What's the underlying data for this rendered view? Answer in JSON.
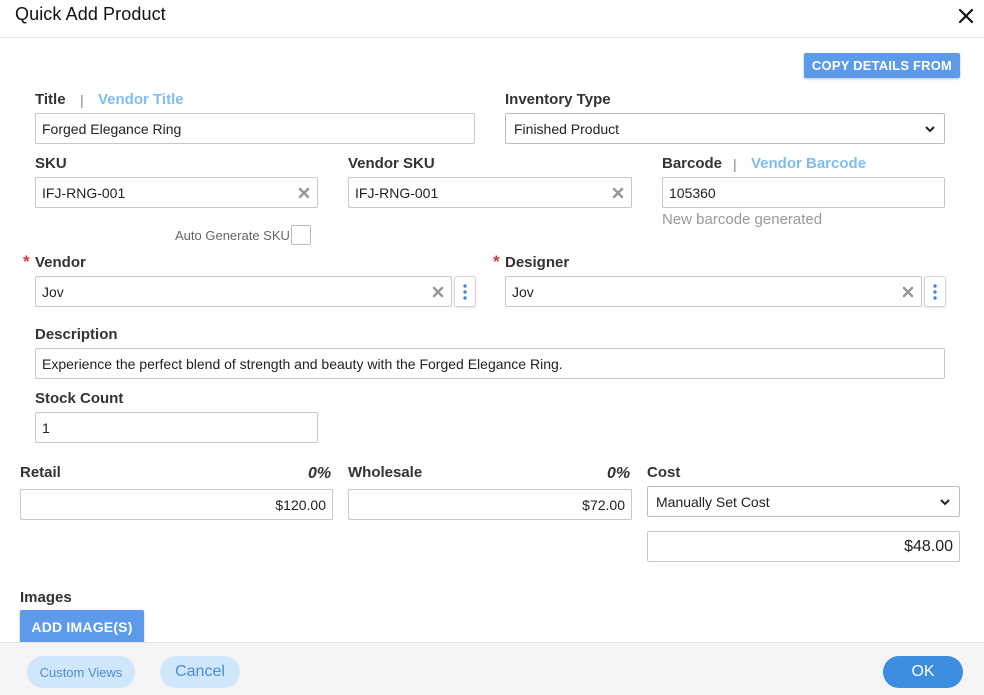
{
  "dialog": {
    "title": "Quick Add Product"
  },
  "actions": {
    "copy_details": "COPY DETAILS FROM"
  },
  "fields": {
    "title": {
      "label": "Title",
      "separator": "|",
      "alt_label": "Vendor Title",
      "value": "Forged Elegance Ring"
    },
    "inventory_type": {
      "label": "Inventory Type",
      "value": "Finished Product"
    },
    "sku": {
      "label": "SKU",
      "value": "IFJ-RNG-001"
    },
    "vendor_sku": {
      "label": "Vendor SKU",
      "value": "IFJ-RNG-001"
    },
    "barcode": {
      "label": "Barcode",
      "separator": "|",
      "alt_label": "Vendor Barcode",
      "value": "105360",
      "hint": "New barcode generated"
    },
    "auto_sku": {
      "label": "Auto Generate SKU",
      "checked": false
    },
    "vendor": {
      "required_mark": "*",
      "label": "Vendor",
      "value": "Jov"
    },
    "designer": {
      "required_mark": "*",
      "label": "Designer",
      "value": "Jov"
    },
    "description": {
      "label": "Description",
      "value": "Experience the perfect blend of strength and beauty with the Forged Elegance Ring."
    },
    "stock_count": {
      "label": "Stock Count",
      "value": "1"
    },
    "retail": {
      "label": "Retail",
      "percent": "0%",
      "value": "$120.00"
    },
    "wholesale": {
      "label": "Wholesale",
      "percent": "0%",
      "value": "$72.00"
    },
    "cost": {
      "label": "Cost",
      "method": "Manually Set Cost",
      "value": "$48.00"
    }
  },
  "images": {
    "label": "Images",
    "add_button": "ADD IMAGE(S)"
  },
  "footer": {
    "custom_views": "Custom Views",
    "cancel": "Cancel",
    "ok": "OK"
  },
  "icons": {
    "close": "close-icon",
    "clear": "clear-x-icon",
    "dropdown": "chevron-down-icon",
    "more": "kebab-menu-icon"
  },
  "colors": {
    "accent": "#5b9bea",
    "link": "#7fbdf0",
    "required": "#d33333",
    "ok_button": "#3d8de0",
    "pill_light": "#cfe6fb"
  }
}
